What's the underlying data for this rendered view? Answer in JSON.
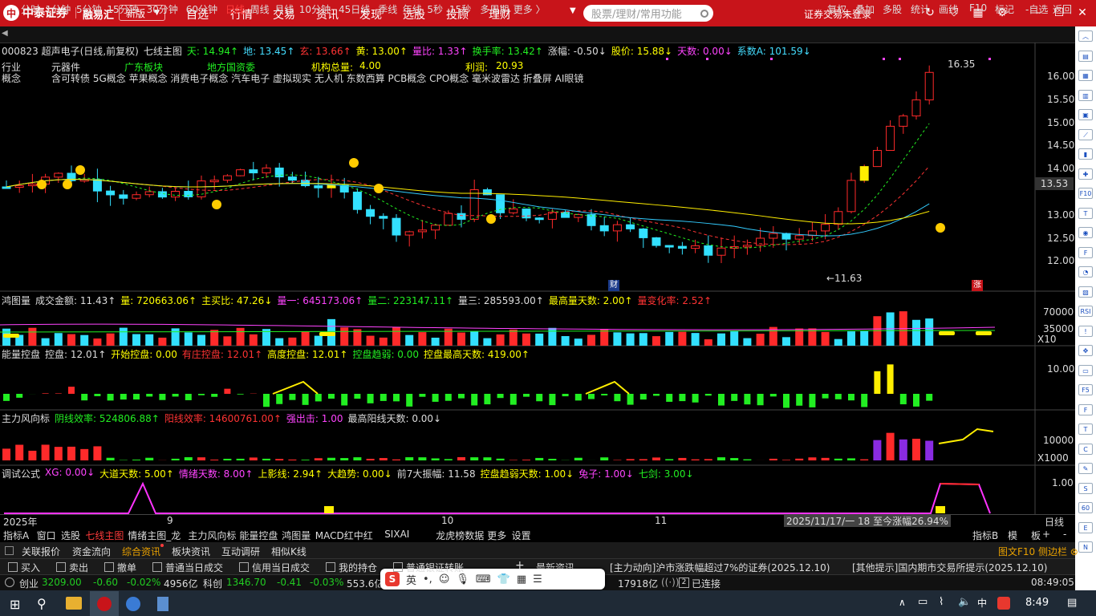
{
  "topbar": {
    "brand": "中泰证券",
    "brand_mark": "中",
    "sub_brand": "融易汇",
    "edition": "新版",
    "nav": [
      "自选",
      "行情",
      "交易",
      "资讯",
      "发现",
      "选股",
      "投顾",
      "理财"
    ],
    "search_placeholder": "股票/理财/常用功能",
    "login_status": "证券交易未登录"
  },
  "period_bar": {
    "items": [
      "分时",
      "1分钟",
      "5分钟",
      "15分钟",
      "30分钟",
      "60分钟",
      "日线",
      "周线",
      "月线",
      "10分钟",
      "45日线",
      "季线",
      "年线",
      "5秒",
      "15秒",
      "多周期",
      "更多 〉"
    ],
    "active": "日线",
    "right_items": [
      "复权",
      "叠加",
      "多股",
      "统计",
      "画线",
      "F10",
      "标记",
      "-自选",
      "返回"
    ]
  },
  "main_chart": {
    "header": [
      {
        "text": "000823 超声电子(日线,前复权)",
        "color": "#dddddd"
      },
      {
        "text": "七线主图",
        "color": "#dddddd"
      },
      {
        "text": "天: 14.94↑",
        "color": "#22ee22"
      },
      {
        "text": "地: 13.45↑",
        "color": "#44ddff"
      },
      {
        "text": "玄: 13.66↑",
        "color": "#ff3333"
      },
      {
        "text": "黄: 13.00↑",
        "color": "#ffff00"
      },
      {
        "text": "量比: 1.33↑",
        "color": "#ff44ff"
      },
      {
        "text": "换手率: 13.42↑",
        "color": "#22ee22"
      },
      {
        "text": "涨幅: -0.50↓",
        "color": "#dddddd"
      },
      {
        "text": "股价: 15.88↓",
        "color": "#ffff00"
      },
      {
        "text": "天数: 0.00↓",
        "color": "#ff44ff"
      },
      {
        "text": "系数A: 101.59↓",
        "color": "#44ddff"
      }
    ],
    "info_row1": [
      {
        "text": "行业",
        "color": "#dddddd"
      },
      {
        "text": "元器件",
        "color": "#dddddd"
      },
      {
        "text": "广东板块",
        "color": "#22ee22"
      },
      {
        "text": "地方国资委",
        "color": "#22ee22"
      },
      {
        "text": "机构总量:",
        "color": "#ffff00"
      },
      {
        "text": "4.00",
        "color": "#ffff00"
      },
      {
        "text": "利润:",
        "color": "#ffff00"
      },
      {
        "text": "20.93",
        "color": "#ffff00"
      }
    ],
    "info_row2_label": "概念",
    "info_row2": "含可转债 5G概念 苹果概念 消费电子概念 汽车电子 虚拟现实 无人机 东数西算 PCB概念 CPO概念 毫米波雷达 折叠屏 AI眼镜",
    "high_label": "16.35",
    "low_label": "←11.63",
    "y_ticks": [
      "16.00",
      "15.50",
      "15.00",
      "14.50",
      "14.00",
      "13.50",
      "13.00",
      "12.50",
      "12.00"
    ],
    "current_price": "13.53",
    "marker_cai": "财",
    "marker_zhang": "涨"
  },
  "volume_panel": {
    "header": [
      {
        "text": "鸿图量",
        "color": "#dddddd"
      },
      {
        "text": "成交金额: 11.43↑",
        "color": "#dddddd"
      },
      {
        "text": "量: 720663.06↑",
        "color": "#ffff00"
      },
      {
        "text": "主买比: 47.26↓",
        "color": "#ffff00"
      },
      {
        "text": "量一: 645173.06↑",
        "color": "#ff44ff"
      },
      {
        "text": "量二: 223147.11↑",
        "color": "#22ee22"
      },
      {
        "text": "量三: 285593.00↑",
        "color": "#dddddd"
      },
      {
        "text": "最高量天数: 2.00↑",
        "color": "#ffff00"
      },
      {
        "text": "量变化率: 2.52↑",
        "color": "#ff3333"
      }
    ],
    "y_ticks": [
      "70000",
      "35000"
    ],
    "unit": "X10"
  },
  "energy_panel": {
    "header": [
      {
        "text": "能量控盘",
        "color": "#dddddd"
      },
      {
        "text": "控盘: 12.01↑",
        "color": "#dddddd"
      },
      {
        "text": "开始控盘: 0.00",
        "color": "#ffff00"
      },
      {
        "text": "有庄控盘: 12.01↑",
        "color": "#ff3333"
      },
      {
        "text": "高度控盘: 12.01↑",
        "color": "#ffff00"
      },
      {
        "text": "控盘趋弱: 0.00",
        "color": "#22ee22"
      },
      {
        "text": "控盘最高天数: 419.00↑",
        "color": "#ffff00"
      }
    ],
    "y_ticks": [
      "10.00"
    ]
  },
  "force_panel": {
    "header": [
      {
        "text": "主力风向标",
        "color": "#dddddd"
      },
      {
        "text": "阴线效率: 524806.88↑",
        "color": "#22ee22"
      },
      {
        "text": "阳线效率: 14600761.00↑",
        "color": "#ff3333"
      },
      {
        "text": "强出击: 1.00",
        "color": "#ff44ff"
      },
      {
        "text": "最高阳线天数: 0.00↓",
        "color": "#dddddd"
      }
    ],
    "y_ticks": [
      "10000"
    ],
    "unit": "X1000"
  },
  "debug_panel": {
    "header": [
      {
        "text": "调试公式",
        "color": "#dddddd"
      },
      {
        "text": "XG: 0.00↓",
        "color": "#ff44ff"
      },
      {
        "text": "大道天数: 5.00↑",
        "color": "#ffff00"
      },
      {
        "text": "情绪天数: 8.00↑",
        "color": "#ff44ff"
      },
      {
        "text": "上影线: 2.94↑",
        "color": "#ffff00"
      },
      {
        "text": "大趋势: 0.00↓",
        "color": "#ffff00"
      },
      {
        "text": "前7大振幅: 11.58",
        "color": "#dddddd"
      },
      {
        "text": "控盘趋弱天数: 1.00↓",
        "color": "#ffff00"
      },
      {
        "text": "兔子: 1.00↓",
        "color": "#ff44ff"
      },
      {
        "text": "七剑: 3.00↓",
        "color": "#22ee22"
      }
    ],
    "y_ticks": [
      "1.00"
    ]
  },
  "x_axis": {
    "labels": [
      "2025年",
      "9",
      "10",
      "11"
    ],
    "date_info": "2025/11/17/一 18 至今涨幅26.94%",
    "period": "日线"
  },
  "tab_bar": {
    "items": [
      "指标A",
      "窗口",
      "选股",
      "七线主图",
      "情绪主图_龙",
      "主力风向标",
      "能量控盘",
      "鸿图量",
      "MACD红中红",
      "SIXAI",
      "龙虎榜数据",
      "更多",
      "设置"
    ],
    "active": "七线主图",
    "right_items": [
      "指标B",
      "模",
      "板",
      "+",
      "-"
    ]
  },
  "bottom_row1": {
    "items": [
      "关联报价",
      "资金流向",
      "综合资讯",
      "板块资讯",
      "互动调研",
      "相似K线"
    ],
    "active": "综合资讯",
    "right": "图文F10 侧边栏 ⊗"
  },
  "bottom_row2": {
    "items": [
      "买入",
      "卖出",
      "撤单",
      "普通当日成交",
      "信用当日成交",
      "我的持仓",
      "普通银证转账"
    ],
    "news1": "[主力动向]沪市涨跌幅超过7%的证券(2025.12.10)",
    "news2": "[其他提示]国内期市交易所提示(2025.12.10)",
    "news_label": "最新资讯"
  },
  "status_row": {
    "index_name": "创业",
    "index_value": "3209.00",
    "index_change": "-0.60",
    "index_pct": "-0.02%",
    "index_amount": "4956亿",
    "index2_name": "科创",
    "index2_value": "1346.70",
    "index2_change": "-0.41",
    "index2_pct": "-0.03%",
    "index2_amount": "553.6亿",
    "total_amount": "17918亿",
    "connection": "已连接",
    "time": "08:49:05"
  },
  "ime": {
    "label": "英"
  },
  "taskbar": {
    "time": "8:49"
  }
}
